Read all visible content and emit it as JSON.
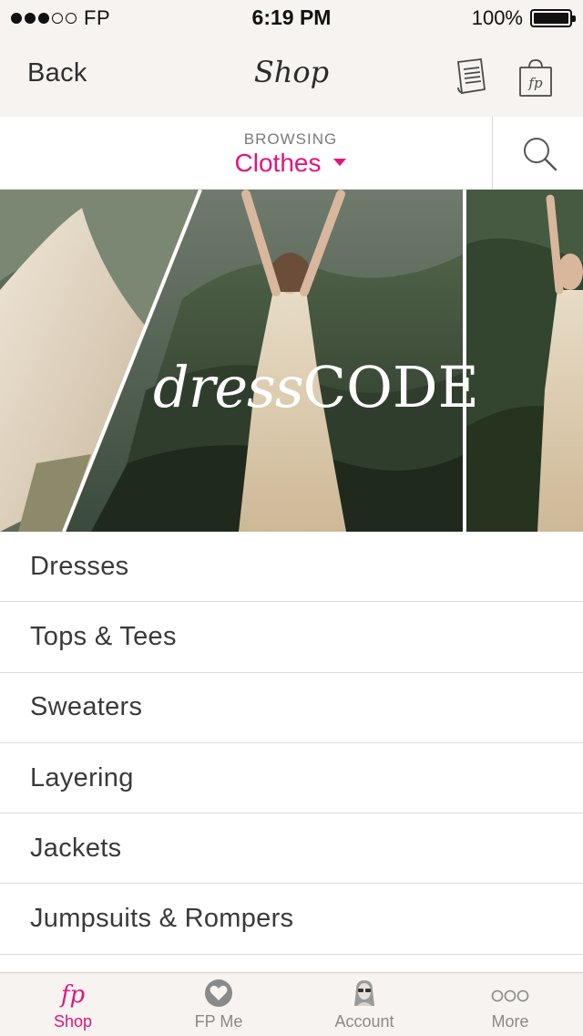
{
  "status_bar": {
    "carrier": "FP",
    "time": "6:19 PM",
    "battery": "100%",
    "signal_bars_filled": 3,
    "signal_bars_total": 5
  },
  "nav": {
    "back_label": "Back",
    "title": "Shop",
    "icons": [
      "notes-icon",
      "shopping-bag-icon"
    ],
    "bag_monogram": "fp"
  },
  "browse": {
    "kicker": "BROWSING",
    "value": "Clothes",
    "accent_color": "#e4137b",
    "search_icon": "search-icon"
  },
  "hero": {
    "word_script": "dress",
    "word_caps": "CODE"
  },
  "categories": [
    {
      "label": "Dresses"
    },
    {
      "label": "Tops & Tees"
    },
    {
      "label": "Sweaters"
    },
    {
      "label": "Layering"
    },
    {
      "label": "Jackets"
    },
    {
      "label": "Jumpsuits & Rompers"
    },
    {
      "label": ""
    }
  ],
  "tabs": [
    {
      "label": "Shop",
      "icon": "fp-script-icon",
      "active": true
    },
    {
      "label": "FP Me",
      "icon": "fp-me-heart-icon",
      "active": false
    },
    {
      "label": "Account",
      "icon": "account-avatar-icon",
      "active": false
    },
    {
      "label": "More",
      "icon": "more-dots-icon",
      "active": false
    }
  ]
}
